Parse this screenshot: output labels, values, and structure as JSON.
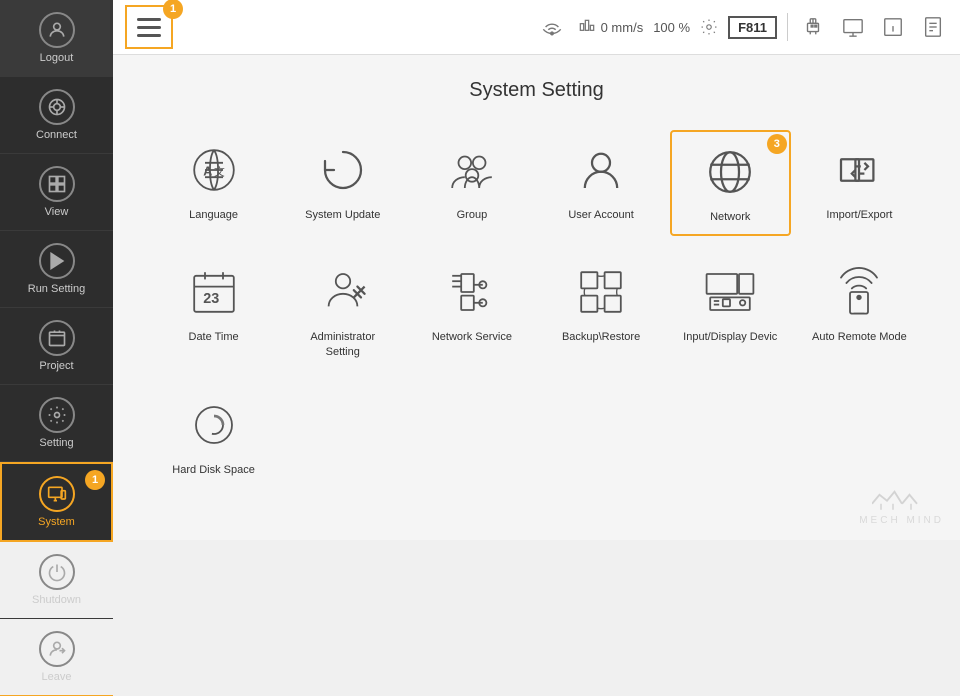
{
  "sidebar": {
    "items": [
      {
        "id": "logout",
        "label": "Logout",
        "icon": "👤"
      },
      {
        "id": "connect",
        "label": "Connect",
        "icon": "🔗"
      },
      {
        "id": "view",
        "label": "View",
        "icon": "📋"
      },
      {
        "id": "run-setting",
        "label": "Run Setting",
        "icon": "▶"
      },
      {
        "id": "project",
        "label": "Project",
        "icon": "🗂"
      },
      {
        "id": "setting",
        "label": "Setting",
        "icon": "⚙"
      },
      {
        "id": "system",
        "label": "System",
        "icon": "🖥"
      },
      {
        "id": "shutdown",
        "label": "Shutdown",
        "icon": "⏻"
      },
      {
        "id": "leave",
        "label": "Leave",
        "icon": "↩"
      }
    ]
  },
  "topbar": {
    "speed_label": "0 mm/s",
    "percent_label": "100 %",
    "model_label": "F811",
    "badge1": "1"
  },
  "content": {
    "title": "System Setting",
    "row1": [
      {
        "id": "language",
        "label": "Language"
      },
      {
        "id": "system-update",
        "label": "System Update"
      },
      {
        "id": "group",
        "label": "Group"
      },
      {
        "id": "user-account",
        "label": "User Account"
      },
      {
        "id": "network",
        "label": "Network",
        "selected": true
      },
      {
        "id": "import-export",
        "label": "Import/Export"
      }
    ],
    "row2": [
      {
        "id": "date-time",
        "label": "Date Time"
      },
      {
        "id": "admin-setting",
        "label": "Administrator\nSetting"
      },
      {
        "id": "network-service",
        "label": "Network Service"
      },
      {
        "id": "backup-restore",
        "label": "Backup\\Restore"
      },
      {
        "id": "input-display",
        "label": "Input/Display Devic"
      },
      {
        "id": "auto-remote-mode",
        "label": "Auto Remote Mode"
      }
    ],
    "row3": [
      {
        "id": "hard-disk-space",
        "label": "Hard Disk Space"
      }
    ]
  },
  "badges": {
    "menu_badge": "1",
    "network_badge": "3"
  },
  "logo": {
    "text": "MECH MIND"
  }
}
